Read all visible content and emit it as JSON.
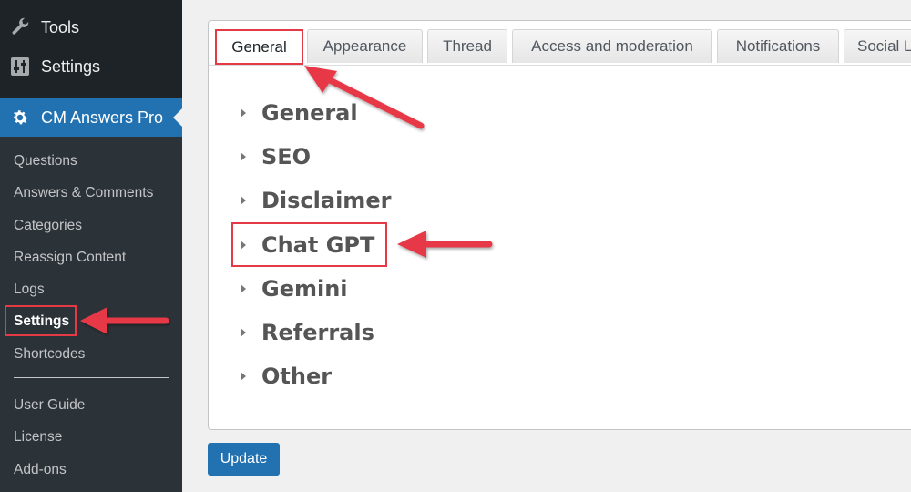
{
  "sidebar": {
    "tools_label": "Tools",
    "settings_label": "Settings",
    "plugin_label": "CM Answers Pro",
    "submenu": [
      {
        "label": "Questions"
      },
      {
        "label": "Answers & Comments"
      },
      {
        "label": "Categories"
      },
      {
        "label": "Reassign Content"
      },
      {
        "label": "Logs"
      },
      {
        "label": "Settings",
        "active": true
      },
      {
        "label": "Shortcodes"
      },
      {
        "label": "User Guide"
      },
      {
        "label": "License"
      },
      {
        "label": "Add-ons"
      }
    ]
  },
  "tabs": [
    {
      "label": "General",
      "active": true
    },
    {
      "label": "Appearance"
    },
    {
      "label": "Thread"
    },
    {
      "label": "Access and moderation"
    },
    {
      "label": "Notifications"
    },
    {
      "label": "Social L"
    }
  ],
  "sections": [
    {
      "label": "General"
    },
    {
      "label": "SEO"
    },
    {
      "label": "Disclaimer"
    },
    {
      "label": "Chat GPT"
    },
    {
      "label": "Gemini"
    },
    {
      "label": "Referrals"
    },
    {
      "label": "Other"
    }
  ],
  "update_label": "Update",
  "colors": {
    "sidebar_bg": "#1d2327",
    "submenu_bg": "#2c3338",
    "accent": "#2271b1",
    "annotation": "#e63946"
  }
}
